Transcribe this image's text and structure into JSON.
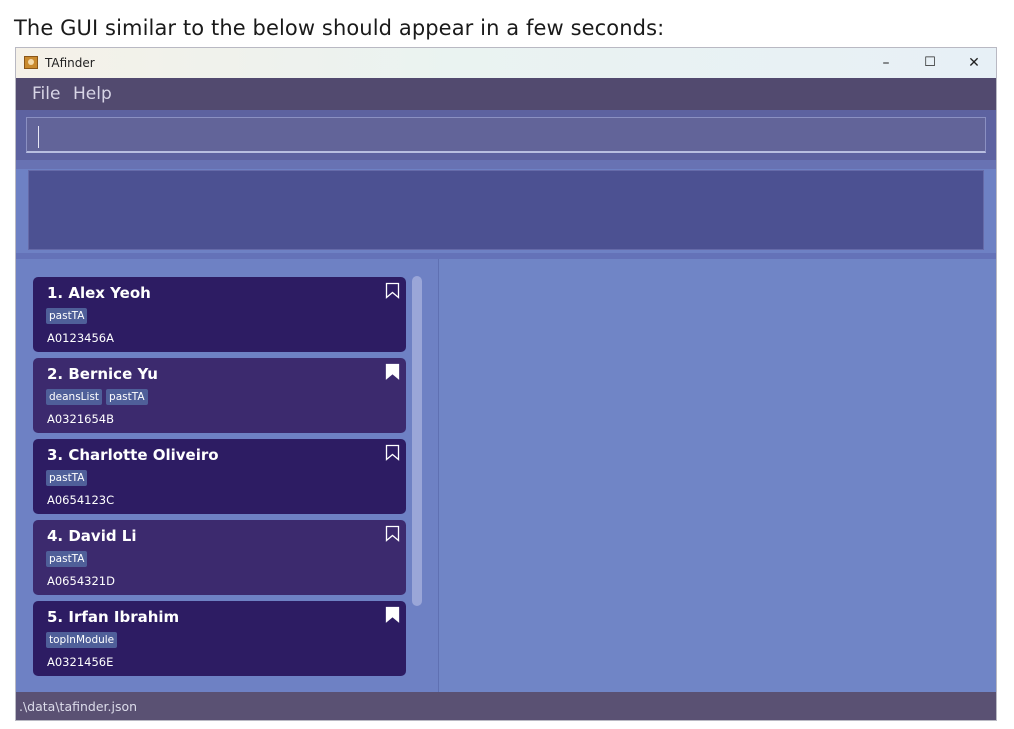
{
  "caption": "The GUI similar to the below should appear in a few seconds:",
  "window": {
    "title": "TAfinder",
    "controls": {
      "minimize": "–",
      "maximize": "☐",
      "close": "✕"
    }
  },
  "menu": [
    "File",
    "Help"
  ],
  "command": {
    "value": "",
    "placeholder": ""
  },
  "result": {
    "text": ""
  },
  "persons": [
    {
      "index_name": "1.  Alex Yeoh",
      "tags": [
        "pastTA"
      ],
      "id": "A0123456A",
      "bookmarked": false
    },
    {
      "index_name": "2.  Bernice Yu",
      "tags": [
        "deansList",
        "pastTA"
      ],
      "id": "A0321654B",
      "bookmarked": true
    },
    {
      "index_name": "3.  Charlotte Oliveiro",
      "tags": [
        "pastTA"
      ],
      "id": "A0654123C",
      "bookmarked": false
    },
    {
      "index_name": "4.  David Li",
      "tags": [
        "pastTA"
      ],
      "id": "A0654321D",
      "bookmarked": false
    },
    {
      "index_name": "5.  Irfan Ibrahim",
      "tags": [
        "topInModule"
      ],
      "id": "A0321456E",
      "bookmarked": true
    }
  ],
  "status": {
    "path": ".\\data\\tafinder.json"
  },
  "colors": {
    "card_dark": "#2d1c63",
    "card_light": "#3c2a6e",
    "tag": "#4f5f99",
    "pane": "#6e81c4",
    "menubar": "#524a6f"
  },
  "icons": {
    "bookmark": "bookmark-icon",
    "app": "app-icon"
  }
}
